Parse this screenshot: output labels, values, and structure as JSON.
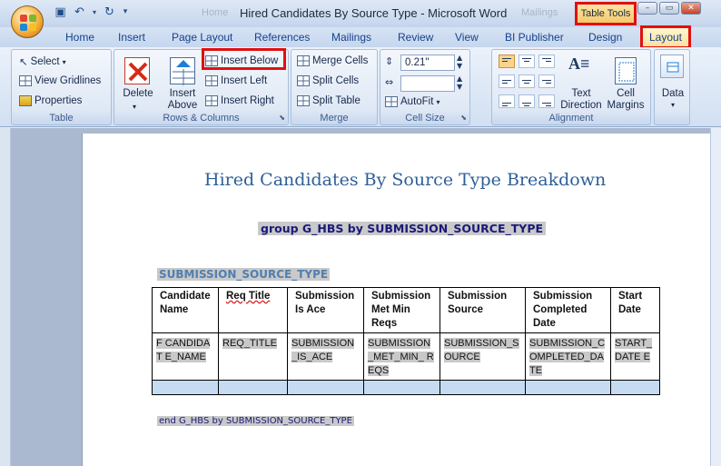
{
  "window": {
    "title": "Hired Candidates By Source Type - Microsoft Word",
    "contextual_tab_group": "Table Tools",
    "ghost_left": "Home",
    "ghost_right": "Mailings"
  },
  "tabs": [
    "Home",
    "Insert",
    "Page Layout",
    "References",
    "Mailings",
    "Review",
    "View",
    "BI Publisher",
    "Design",
    "Layout"
  ],
  "ribbon": {
    "table_group": {
      "label": "Table",
      "select": "Select",
      "view_gridlines": "View Gridlines",
      "properties": "Properties"
    },
    "rows_columns_group": {
      "label": "Rows & Columns",
      "delete": "Delete",
      "insert_above_line1": "Insert",
      "insert_above_line2": "Above",
      "insert_below": "Insert Below",
      "insert_left": "Insert Left",
      "insert_right": "Insert Right"
    },
    "merge_group": {
      "label": "Merge",
      "merge_cells": "Merge Cells",
      "split_cells": "Split Cells",
      "split_table": "Split Table"
    },
    "cell_size_group": {
      "label": "Cell Size",
      "height_value": "0.21\"",
      "width_value": "",
      "autofit": "AutoFit"
    },
    "alignment_group": {
      "label": "Alignment",
      "text_direction_line1": "Text",
      "text_direction_line2": "Direction",
      "cell_margins_line1": "Cell",
      "cell_margins_line2": "Margins"
    },
    "data_group": {
      "label": "Data"
    }
  },
  "document": {
    "heading": "Hired Candidates By Source Type Breakdown",
    "group_field": "group G_HBS by SUBMISSION_SOURCE_TYPE",
    "section_field": "SUBMISSION_SOURCE_TYPE",
    "end_field": "end G_HBS by SUBMISSION_SOURCE_TYPE",
    "table": {
      "headers": [
        "Candidate Name",
        "Req Title",
        "Submission Is Ace",
        "Submission Met Min Reqs",
        "Submission Source",
        "Submission Completed Date",
        "Start Date"
      ],
      "row": [
        "F CANDIDAT E_NAME",
        "REQ_TITLE",
        "SUBMISSION _IS_ACE",
        "SUBMISSION _MET_MIN_ REQS",
        "SUBMISSION_S OURCE",
        "SUBMISSION_C OMPLETED_DA TE",
        "START_ DATE E"
      ]
    }
  }
}
